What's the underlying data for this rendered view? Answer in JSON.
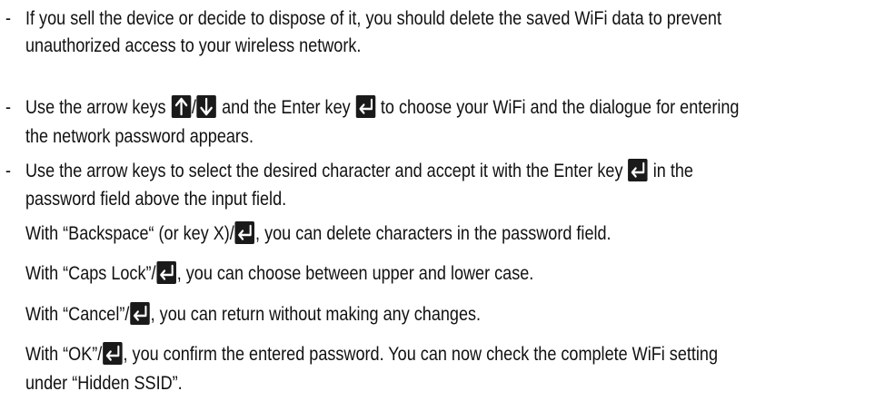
{
  "bullets": {
    "dash": "-"
  },
  "icons": {
    "enter_key": "enter-key-icon",
    "arrow_up_key": "arrow-up-key-icon",
    "arrow_down_key": "arrow-down-key-icon"
  },
  "colors": {
    "text": "#111111",
    "key_bg": "#1a1a1a",
    "key_symbol": "#ffffff"
  },
  "p1": {
    "l1": "If you sell the device or decide to dispose of it, you should delete the saved WiFi data to prevent",
    "l2": "unauthorized access to your wireless network."
  },
  "p2": {
    "l1_a": "Use the arrow keys ",
    "l1_sep": "/",
    "l1_b": " and the Enter key ",
    "l1_c": " to choose your WiFi and the dialogue for entering",
    "l2": "the network password appears."
  },
  "p3": {
    "l1_a": "Use the arrow keys to select the desired character and accept it with the Enter key ",
    "l1_b": " in the",
    "l2": "password field above the input field."
  },
  "p4": {
    "a": "With “Backspace“ (or key X)/",
    "b": ", you can delete characters in the password field."
  },
  "p5": {
    "a": "With “Caps Lock”/",
    "b": ", you can choose between upper and lower case."
  },
  "p6": {
    "a": "With “Cancel”/",
    "b": ", you can return without making any changes."
  },
  "p7": {
    "l1_a": "With “OK”/",
    "l1_b": ", you confirm the entered password. You can now check the complete WiFi setting",
    "l2": "under “Hidden SSID”."
  }
}
